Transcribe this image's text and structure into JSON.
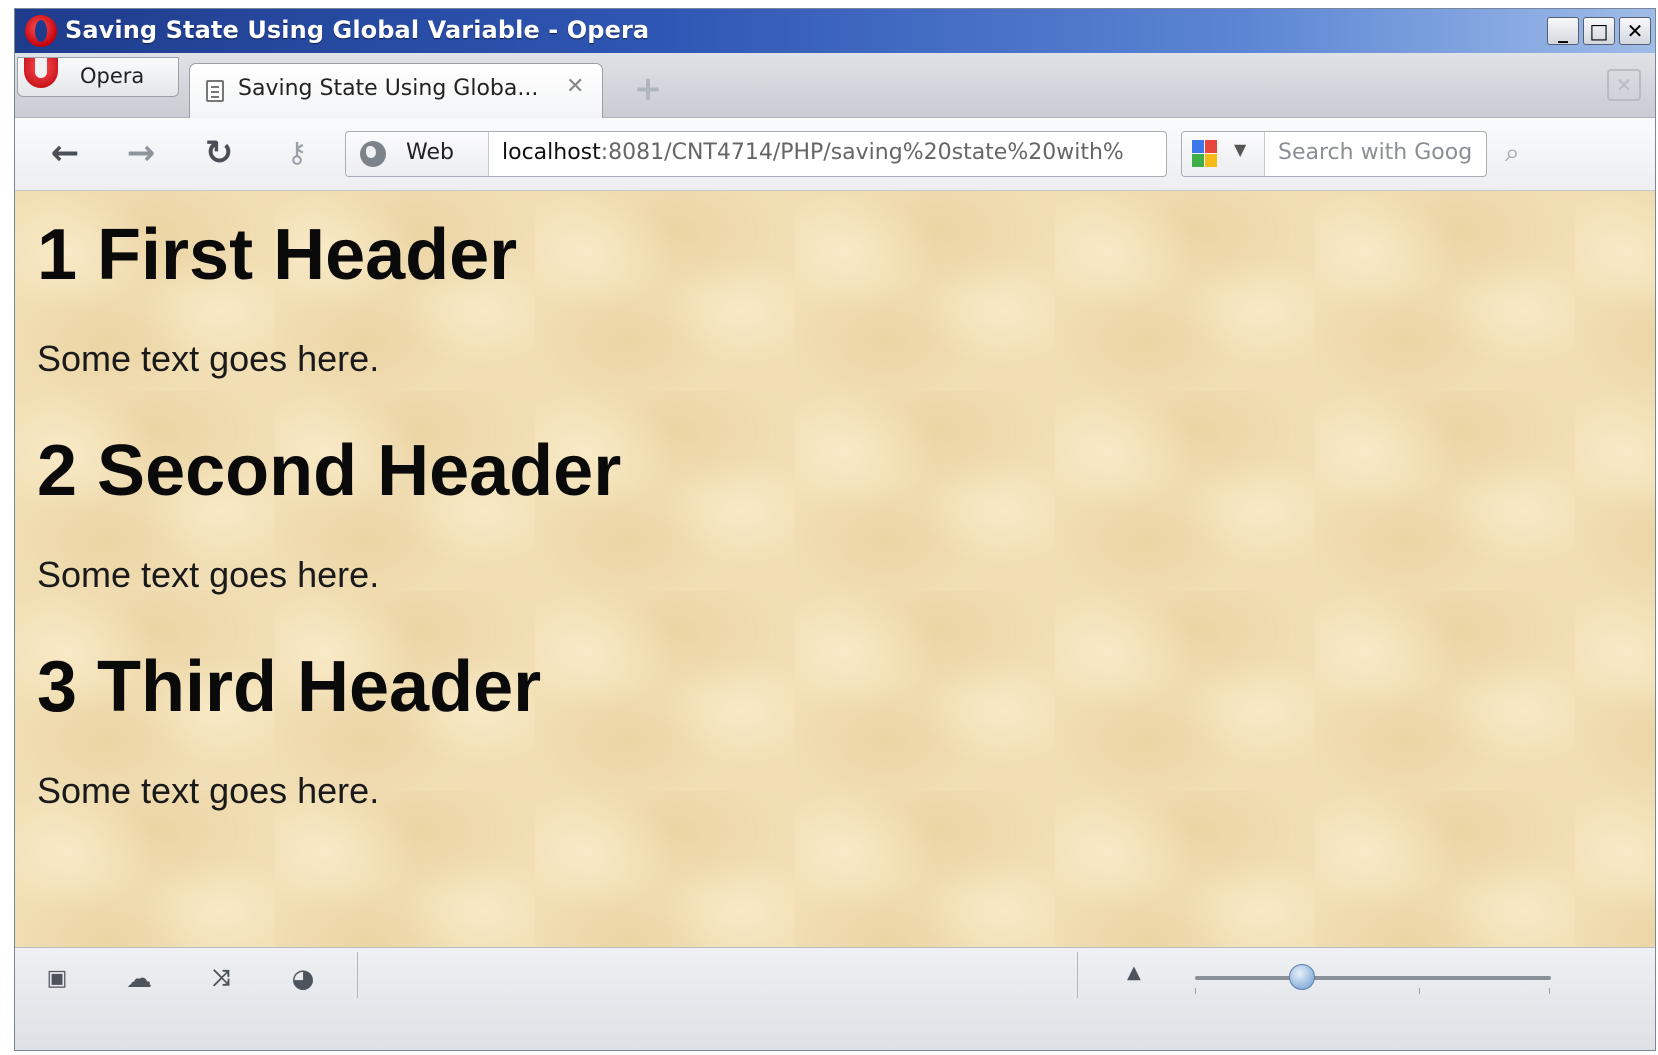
{
  "window": {
    "title": "Saving State Using Global Variable - Opera",
    "controls": {
      "minimize": "_",
      "maximize": "□",
      "close": "✕"
    }
  },
  "tabs": {
    "menu_label": "Opera",
    "active_title": "Saving State Using Globa...",
    "close_glyph": "✕",
    "new_tab_glyph": "+"
  },
  "toolbar": {
    "back": "back-arrow",
    "forward": "forward-arrow",
    "reload": "reload",
    "wand": "key",
    "address_segment_label": "Web",
    "url_host": "localhost",
    "url_rest": ":8081/CNT4714/PHP/saving%20state%20with%",
    "search_placeholder": "Search with Goog",
    "search_engine": "Google"
  },
  "content": {
    "sections": [
      {
        "heading": "1 First Header",
        "text": "Some text goes here."
      },
      {
        "heading": "2 Second Header",
        "text": "Some text goes here."
      },
      {
        "heading": "3 Third Header",
        "text": "Some text goes here."
      }
    ],
    "background_color": "#f1deb4"
  },
  "statusbar": {
    "icons": [
      "panels-icon",
      "cloud-icon",
      "share-icon",
      "speed-dial-icon"
    ],
    "zoom_level_fraction": 0.3
  },
  "colors": {
    "titlebar_start": "#1e3c8c",
    "titlebar_end": "#9fbce8",
    "opera_red": "#c4000b"
  }
}
